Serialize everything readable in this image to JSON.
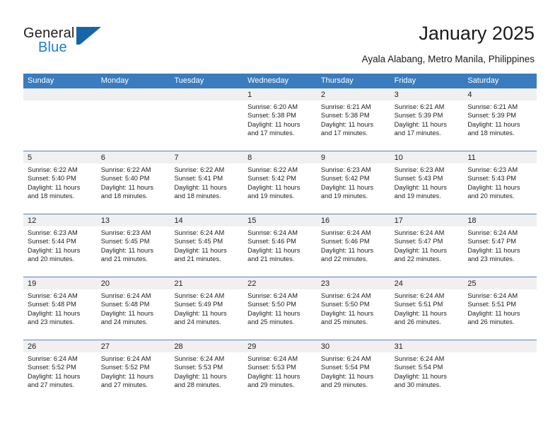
{
  "logo": {
    "word_one": "General",
    "word_two": "Blue",
    "mark": "flag-triangle-icon",
    "accent_color": "#1565a8",
    "text_color": "#231f20"
  },
  "header": {
    "title": "January 2025",
    "subtitle": "Ayala Alabang, Metro Manila, Philippines"
  },
  "theme": {
    "header_row_bg": "#3a7cbe",
    "header_row_text": "#ffffff",
    "daynum_band_bg": "#f0f0f0",
    "row_divider": "#5b85b5",
    "cell_bg": "#ffffff"
  },
  "calendar": {
    "weekdays": [
      "Sunday",
      "Monday",
      "Tuesday",
      "Wednesday",
      "Thursday",
      "Friday",
      "Saturday"
    ],
    "labels": {
      "sunrise": "Sunrise:",
      "sunset": "Sunset:",
      "daylight": "Daylight:"
    },
    "weeks": [
      [
        {
          "day": "",
          "lines": []
        },
        {
          "day": "",
          "lines": []
        },
        {
          "day": "",
          "lines": []
        },
        {
          "day": "1",
          "lines": [
            "Sunrise: 6:20 AM",
            "Sunset: 5:38 PM",
            "Daylight: 11 hours",
            "and 17 minutes."
          ]
        },
        {
          "day": "2",
          "lines": [
            "Sunrise: 6:21 AM",
            "Sunset: 5:38 PM",
            "Daylight: 11 hours",
            "and 17 minutes."
          ]
        },
        {
          "day": "3",
          "lines": [
            "Sunrise: 6:21 AM",
            "Sunset: 5:39 PM",
            "Daylight: 11 hours",
            "and 17 minutes."
          ]
        },
        {
          "day": "4",
          "lines": [
            "Sunrise: 6:21 AM",
            "Sunset: 5:39 PM",
            "Daylight: 11 hours",
            "and 18 minutes."
          ]
        }
      ],
      [
        {
          "day": "5",
          "lines": [
            "Sunrise: 6:22 AM",
            "Sunset: 5:40 PM",
            "Daylight: 11 hours",
            "and 18 minutes."
          ]
        },
        {
          "day": "6",
          "lines": [
            "Sunrise: 6:22 AM",
            "Sunset: 5:40 PM",
            "Daylight: 11 hours",
            "and 18 minutes."
          ]
        },
        {
          "day": "7",
          "lines": [
            "Sunrise: 6:22 AM",
            "Sunset: 5:41 PM",
            "Daylight: 11 hours",
            "and 18 minutes."
          ]
        },
        {
          "day": "8",
          "lines": [
            "Sunrise: 6:22 AM",
            "Sunset: 5:42 PM",
            "Daylight: 11 hours",
            "and 19 minutes."
          ]
        },
        {
          "day": "9",
          "lines": [
            "Sunrise: 6:23 AM",
            "Sunset: 5:42 PM",
            "Daylight: 11 hours",
            "and 19 minutes."
          ]
        },
        {
          "day": "10",
          "lines": [
            "Sunrise: 6:23 AM",
            "Sunset: 5:43 PM",
            "Daylight: 11 hours",
            "and 19 minutes."
          ]
        },
        {
          "day": "11",
          "lines": [
            "Sunrise: 6:23 AM",
            "Sunset: 5:43 PM",
            "Daylight: 11 hours",
            "and 20 minutes."
          ]
        }
      ],
      [
        {
          "day": "12",
          "lines": [
            "Sunrise: 6:23 AM",
            "Sunset: 5:44 PM",
            "Daylight: 11 hours",
            "and 20 minutes."
          ]
        },
        {
          "day": "13",
          "lines": [
            "Sunrise: 6:23 AM",
            "Sunset: 5:45 PM",
            "Daylight: 11 hours",
            "and 21 minutes."
          ]
        },
        {
          "day": "14",
          "lines": [
            "Sunrise: 6:24 AM",
            "Sunset: 5:45 PM",
            "Daylight: 11 hours",
            "and 21 minutes."
          ]
        },
        {
          "day": "15",
          "lines": [
            "Sunrise: 6:24 AM",
            "Sunset: 5:46 PM",
            "Daylight: 11 hours",
            "and 21 minutes."
          ]
        },
        {
          "day": "16",
          "lines": [
            "Sunrise: 6:24 AM",
            "Sunset: 5:46 PM",
            "Daylight: 11 hours",
            "and 22 minutes."
          ]
        },
        {
          "day": "17",
          "lines": [
            "Sunrise: 6:24 AM",
            "Sunset: 5:47 PM",
            "Daylight: 11 hours",
            "and 22 minutes."
          ]
        },
        {
          "day": "18",
          "lines": [
            "Sunrise: 6:24 AM",
            "Sunset: 5:47 PM",
            "Daylight: 11 hours",
            "and 23 minutes."
          ]
        }
      ],
      [
        {
          "day": "19",
          "lines": [
            "Sunrise: 6:24 AM",
            "Sunset: 5:48 PM",
            "Daylight: 11 hours",
            "and 23 minutes."
          ]
        },
        {
          "day": "20",
          "lines": [
            "Sunrise: 6:24 AM",
            "Sunset: 5:48 PM",
            "Daylight: 11 hours",
            "and 24 minutes."
          ]
        },
        {
          "day": "21",
          "lines": [
            "Sunrise: 6:24 AM",
            "Sunset: 5:49 PM",
            "Daylight: 11 hours",
            "and 24 minutes."
          ]
        },
        {
          "day": "22",
          "lines": [
            "Sunrise: 6:24 AM",
            "Sunset: 5:50 PM",
            "Daylight: 11 hours",
            "and 25 minutes."
          ]
        },
        {
          "day": "23",
          "lines": [
            "Sunrise: 6:24 AM",
            "Sunset: 5:50 PM",
            "Daylight: 11 hours",
            "and 25 minutes."
          ]
        },
        {
          "day": "24",
          "lines": [
            "Sunrise: 6:24 AM",
            "Sunset: 5:51 PM",
            "Daylight: 11 hours",
            "and 26 minutes."
          ]
        },
        {
          "day": "25",
          "lines": [
            "Sunrise: 6:24 AM",
            "Sunset: 5:51 PM",
            "Daylight: 11 hours",
            "and 26 minutes."
          ]
        }
      ],
      [
        {
          "day": "26",
          "lines": [
            "Sunrise: 6:24 AM",
            "Sunset: 5:52 PM",
            "Daylight: 11 hours",
            "and 27 minutes."
          ]
        },
        {
          "day": "27",
          "lines": [
            "Sunrise: 6:24 AM",
            "Sunset: 5:52 PM",
            "Daylight: 11 hours",
            "and 27 minutes."
          ]
        },
        {
          "day": "28",
          "lines": [
            "Sunrise: 6:24 AM",
            "Sunset: 5:53 PM",
            "Daylight: 11 hours",
            "and 28 minutes."
          ]
        },
        {
          "day": "29",
          "lines": [
            "Sunrise: 6:24 AM",
            "Sunset: 5:53 PM",
            "Daylight: 11 hours",
            "and 29 minutes."
          ]
        },
        {
          "day": "30",
          "lines": [
            "Sunrise: 6:24 AM",
            "Sunset: 5:54 PM",
            "Daylight: 11 hours",
            "and 29 minutes."
          ]
        },
        {
          "day": "31",
          "lines": [
            "Sunrise: 6:24 AM",
            "Sunset: 5:54 PM",
            "Daylight: 11 hours",
            "and 30 minutes."
          ]
        },
        {
          "day": "",
          "lines": []
        }
      ]
    ]
  }
}
